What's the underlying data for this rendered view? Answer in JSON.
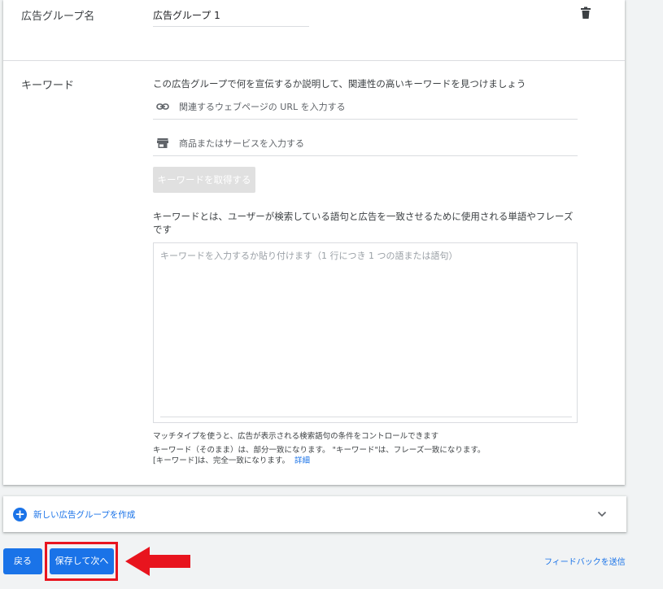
{
  "ad_group": {
    "label": "広告グループ名",
    "name_value": "広告グループ 1",
    "delete_icon": "trash-icon"
  },
  "keywords": {
    "label": "キーワード",
    "description": "この広告グループで何を宣伝するか説明して、関連性の高いキーワードを見つけましょう",
    "url_placeholder": "関連するウェブページの URL を入力する",
    "url_icon": "link-icon",
    "product_placeholder": "商品またはサービスを入力する",
    "product_icon": "store-icon",
    "get_keywords_button": "キーワードを取得する",
    "definition": "キーワードとは、ユーザーが検索している語句と広告を一致させるために使用される単語やフレーズです",
    "textarea_placeholder": "キーワードを入力するか貼り付けます（1 行につき 1 つの語または語句）",
    "help_line1": "マッチタイプを使うと、広告が表示される検索語句の条件をコントロールできます",
    "help_line2": "キーワード（そのまま）は、部分一致になります。 \"キーワード\"は、フレーズ一致になります。",
    "help_line3": "[キーワード]は、完全一致になります。",
    "help_link": "詳細"
  },
  "new_ad_group": {
    "label": "新しい広告グループを作成",
    "icon": "plus-circle-icon",
    "expand_icon": "chevron-down-icon"
  },
  "footer": {
    "back_button": "戻る",
    "save_next_button": "保存して次へ",
    "feedback_link": "フィードバックを送信"
  },
  "colors": {
    "primary": "#1a73e8",
    "annotation": "#e8141e",
    "background": "#f1f3f4"
  }
}
